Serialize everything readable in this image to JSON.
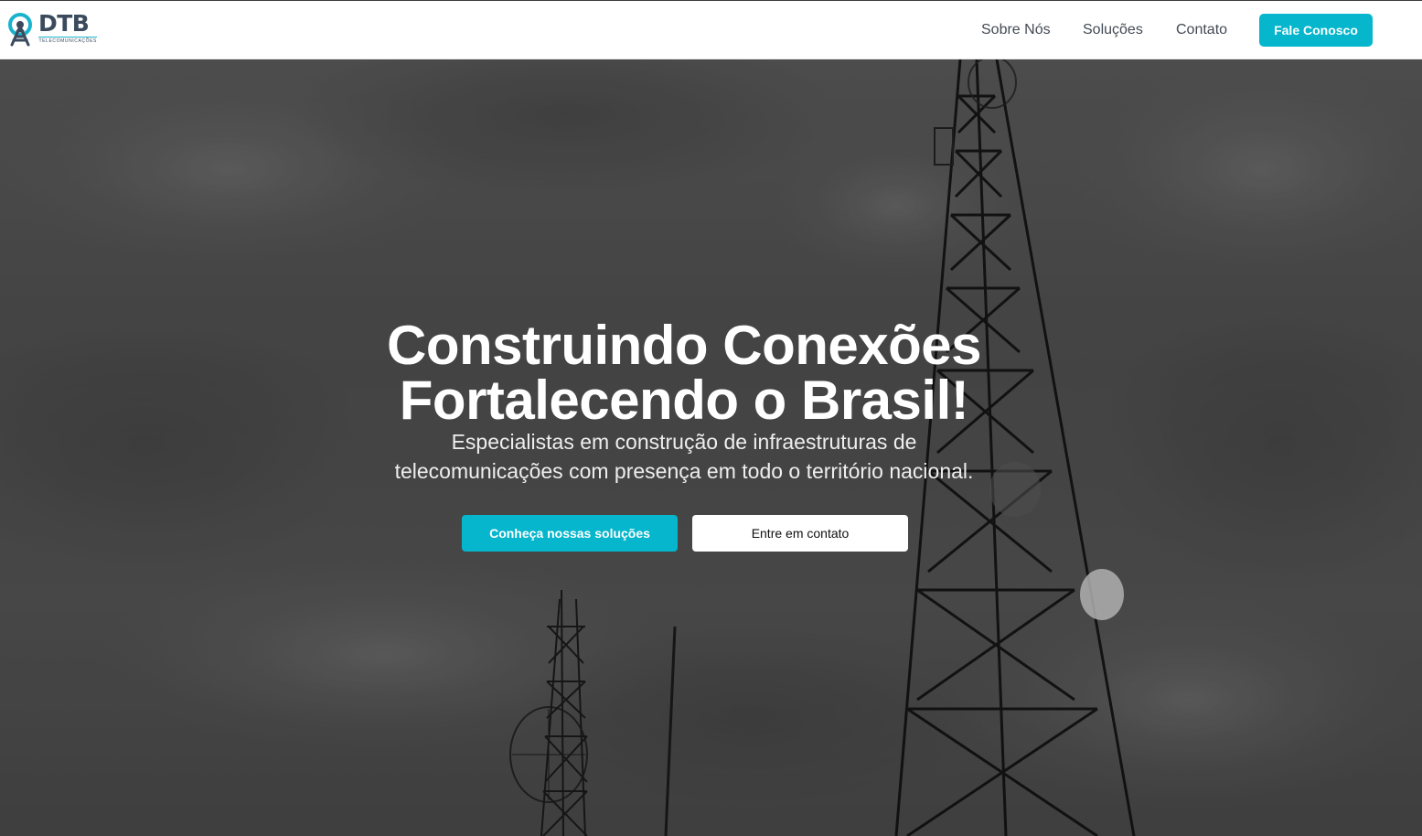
{
  "brand": {
    "name": "DTB",
    "tagline": "TELECOMUNICAÇÕES",
    "accent_color": "#06b6cc",
    "logo_icon": "antenna-tower-icon"
  },
  "nav": {
    "items": [
      {
        "label": "Sobre Nós"
      },
      {
        "label": "Soluções"
      },
      {
        "label": "Contato"
      }
    ],
    "cta_label": "Fale Conosco"
  },
  "hero": {
    "title_line1": "Construindo Conexões",
    "title_line2": "Fortalecendo o Brasil!",
    "subtitle_line1": "Especialistas em construção de infraestruturas de",
    "subtitle_line2": "telecomunicações com presença em todo o território nacional.",
    "primary_button": "Conheça nossas soluções",
    "secondary_button": "Entre em contato",
    "background": "grayscale-telecom-towers-sky"
  }
}
